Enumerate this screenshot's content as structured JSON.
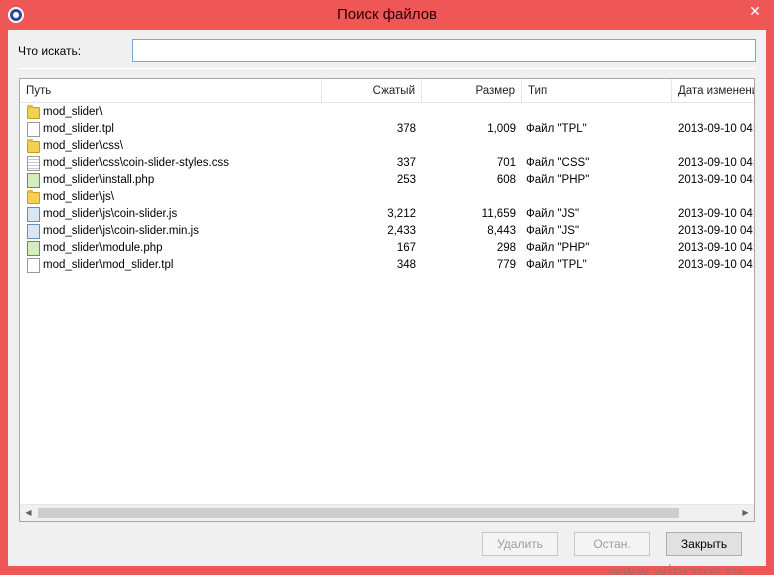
{
  "window": {
    "title": "Поиск файлов",
    "close_glyph": "✕",
    "accent_color": "#ef5757"
  },
  "search": {
    "label": "Что искать:",
    "value": "",
    "placeholder": ""
  },
  "table": {
    "columns": [
      "Путь",
      "Сжатый",
      "Размер",
      "Тип",
      "Дата изменени"
    ],
    "rows": [
      {
        "icon": "folder-icon",
        "path": "mod_slider\\",
        "compressed": "",
        "size": "",
        "type": "",
        "date": ""
      },
      {
        "icon": "tpl-file-icon",
        "path": "mod_slider.tpl",
        "compressed": "378",
        "size": "1,009",
        "type": "Файл \"TPL\"",
        "date": "2013-09-10  04:"
      },
      {
        "icon": "folder-icon",
        "path": "mod_slider\\css\\",
        "compressed": "",
        "size": "",
        "type": "",
        "date": ""
      },
      {
        "icon": "css-file-icon",
        "path": "mod_slider\\css\\coin-slider-styles.css",
        "compressed": "337",
        "size": "701",
        "type": "Файл \"CSS\"",
        "date": "2013-09-10  04:"
      },
      {
        "icon": "php-file-icon",
        "path": "mod_slider\\install.php",
        "compressed": "253",
        "size": "608",
        "type": "Файл \"PHP\"",
        "date": "2013-09-10  04:"
      },
      {
        "icon": "folder-icon",
        "path": "mod_slider\\js\\",
        "compressed": "",
        "size": "",
        "type": "",
        "date": ""
      },
      {
        "icon": "js-file-icon",
        "path": "mod_slider\\js\\coin-slider.js",
        "compressed": "3,212",
        "size": "11,659",
        "type": "Файл \"JS\"",
        "date": "2013-09-10  04:"
      },
      {
        "icon": "js-file-icon",
        "path": "mod_slider\\js\\coin-slider.min.js",
        "compressed": "2,433",
        "size": "8,443",
        "type": "Файл \"JS\"",
        "date": "2013-09-10  04:"
      },
      {
        "icon": "php-file-icon",
        "path": "mod_slider\\module.php",
        "compressed": "167",
        "size": "298",
        "type": "Файл \"PHP\"",
        "date": "2013-09-10  04:"
      },
      {
        "icon": "tpl-file-icon",
        "path": "mod_slider\\mod_slider.tpl",
        "compressed": "348",
        "size": "779",
        "type": "Файл \"TPL\"",
        "date": "2013-09-10  04:"
      }
    ]
  },
  "buttons": {
    "delete_label": "Удалить",
    "stop_label": "Остан.",
    "close_label": "Закрыть"
  },
  "watermark": "www.wincore.ru"
}
